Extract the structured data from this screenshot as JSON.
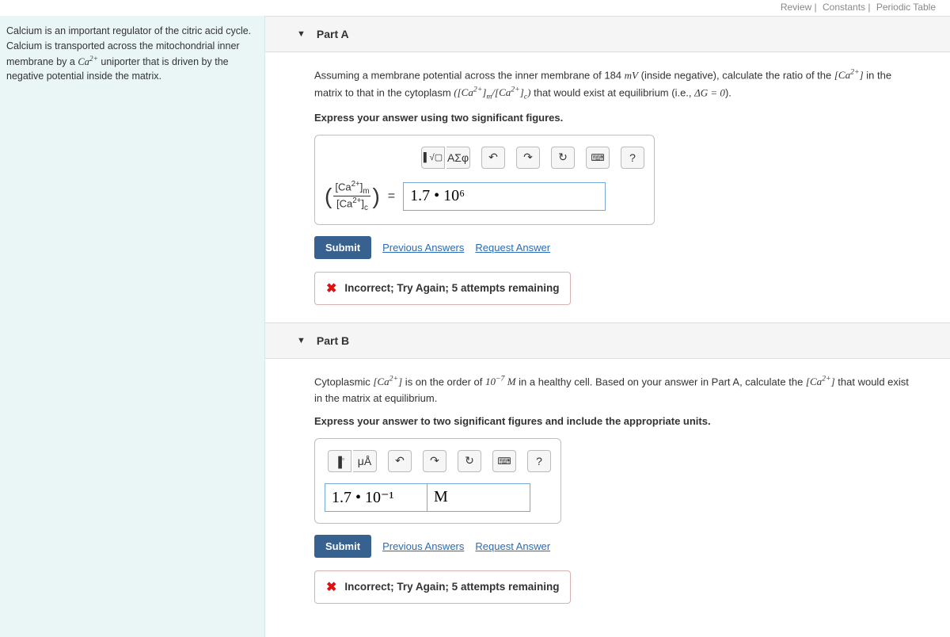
{
  "topLinks": {
    "review": "Review",
    "constants": "Constants",
    "periodic": "Periodic Table"
  },
  "sidebar": {
    "text1": "Calcium is an important regulator of the citric acid cycle. Calcium is transported across the mitochondrial inner membrane by a ",
    "text2": " uniporter that is driven by the negative potential inside the matrix."
  },
  "partA": {
    "title": "Part A",
    "q1a": "Assuming a membrane potential across the inner membrane of 184 ",
    "q1b": " (inside negative), calculate the ratio of the ",
    "q1c": " in the matrix to that in the cytoplasm ",
    "q1d": " that would exist at equilibrium (i.e., ",
    "q1e": ").",
    "bold": "Express your answer using two significant figures.",
    "toolbar": {
      "tmpl": "▢",
      "sqrt": "√▢",
      "sigma": "ΑΣφ",
      "undo": "↶",
      "redo": "↷",
      "reset": "↻",
      "kb": "⌨",
      "help": "?"
    },
    "answerValue": "1.7 • 10⁶",
    "submit": "Submit",
    "prev": "Previous Answers",
    "req": "Request Answer",
    "feedback": "Incorrect; Try Again; 5 attempts remaining"
  },
  "partB": {
    "title": "Part B",
    "q1a": "Cytoplasmic ",
    "q1b": " is on the order of ",
    "q1c": " in a healthy cell. Based on your answer in Part A, calculate the ",
    "q1d": " that would exist in the matrix at equilibrium.",
    "bold": "Express your answer to two significant figures and include the appropriate units.",
    "toolbar": {
      "tmpl1": "▢",
      "tmpl2": "▫",
      "units": "μÅ",
      "undo": "↶",
      "redo": "↷",
      "reset": "↻",
      "kb": "⌨",
      "help": "?"
    },
    "valueAnswer": "1.7 • 10⁻¹",
    "unitAnswer": "M",
    "submit": "Submit",
    "prev": "Previous Answers",
    "req": "Request Answer",
    "feedback": "Incorrect; Try Again; 5 attempts remaining"
  }
}
